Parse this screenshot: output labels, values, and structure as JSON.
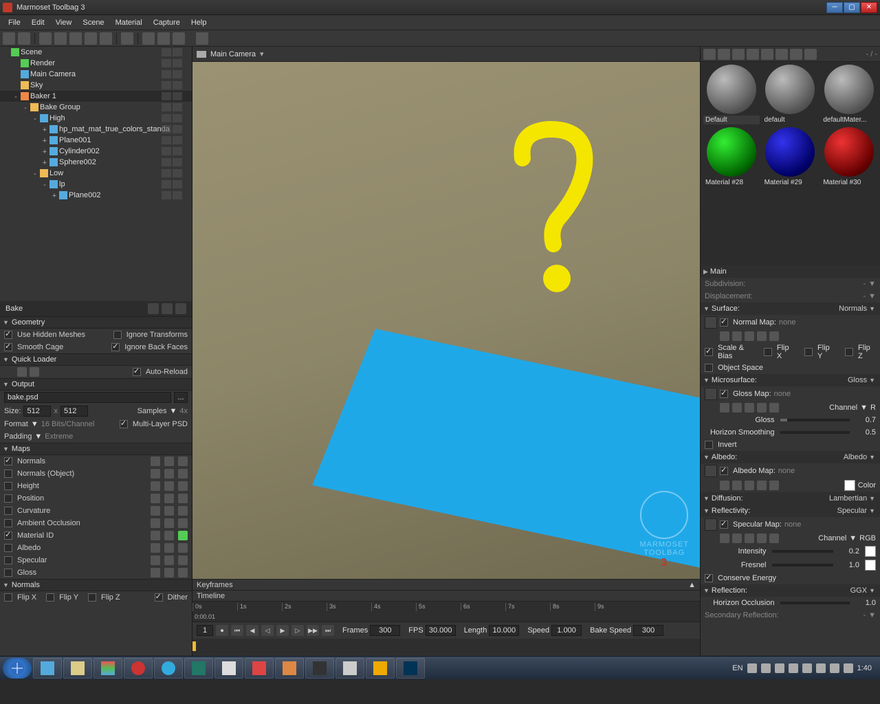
{
  "title": "Marmoset Toolbag 3",
  "menu": [
    "File",
    "Edit",
    "View",
    "Scene",
    "Material",
    "Capture",
    "Help"
  ],
  "camera": "Main Camera",
  "scene_tree": [
    {
      "indent": 0,
      "label": "Scene",
      "ico": "green"
    },
    {
      "indent": 1,
      "label": "Render",
      "ico": "green"
    },
    {
      "indent": 1,
      "label": "Main Camera",
      "ico": "blue"
    },
    {
      "indent": 1,
      "label": "Sky",
      "ico": "yellow"
    },
    {
      "indent": 1,
      "label": "Baker 1",
      "ico": "orange",
      "selected": true,
      "exp": "-"
    },
    {
      "indent": 2,
      "label": "Bake Group",
      "ico": "yellow",
      "exp": "-"
    },
    {
      "indent": 3,
      "label": "High",
      "ico": "blue",
      "exp": "-"
    },
    {
      "indent": 4,
      "label": "hp_mat_mat_true_colors_standa",
      "ico": "blue",
      "exp": "+"
    },
    {
      "indent": 4,
      "label": "Plane001",
      "ico": "blue",
      "exp": "+"
    },
    {
      "indent": 4,
      "label": "Cylinder002",
      "ico": "blue",
      "exp": "+"
    },
    {
      "indent": 4,
      "label": "Sphere002",
      "ico": "blue",
      "exp": "+"
    },
    {
      "indent": 3,
      "label": "Low",
      "ico": "yellow",
      "exp": "-"
    },
    {
      "indent": 4,
      "label": "lp",
      "ico": "blue",
      "exp": "-"
    },
    {
      "indent": 5,
      "label": "Plane002",
      "ico": "blue",
      "exp": "+"
    }
  ],
  "bake": {
    "title": "Bake",
    "geometry": "Geometry",
    "use_hidden": "Use Hidden Meshes",
    "ignore_transforms": "Ignore Transforms",
    "smooth_cage": "Smooth Cage",
    "ignore_backfaces": "Ignore Back Faces",
    "quick_loader": "Quick Loader",
    "auto_reload": "Auto-Reload",
    "output": "Output",
    "filename": "bake.psd",
    "size_label": "Size:",
    "size_w": "512",
    "size_h": "512",
    "samples_label": "Samples",
    "samples_val": "4x",
    "format_label": "Format",
    "format_val": "16 Bits/Channel",
    "multilayer": "Multi-Layer PSD",
    "padding_label": "Padding",
    "padding_val": "Extreme",
    "maps_header": "Maps",
    "maps": [
      {
        "label": "Normals",
        "on": true
      },
      {
        "label": "Normals (Object)",
        "on": false
      },
      {
        "label": "Height",
        "on": false
      },
      {
        "label": "Position",
        "on": false
      },
      {
        "label": "Curvature",
        "on": false
      },
      {
        "label": "Ambient Occlusion",
        "on": false
      },
      {
        "label": "Material ID",
        "on": true,
        "hot": true
      },
      {
        "label": "Albedo",
        "on": false
      },
      {
        "label": "Specular",
        "on": false
      },
      {
        "label": "Gloss",
        "on": false
      }
    ],
    "normals_section": "Normals",
    "flip_x": "Flip X",
    "flip_y": "Flip Y",
    "flip_z": "Flip Z",
    "dither": "Dither"
  },
  "materials": [
    {
      "label": "Default",
      "c": "gray",
      "sel": true
    },
    {
      "label": "default",
      "c": "gray"
    },
    {
      "label": "defaultMater...",
      "c": "gray"
    },
    {
      "label": "Material #28",
      "c": "green"
    },
    {
      "label": "Material #29",
      "c": "blue"
    },
    {
      "label": "Material #30",
      "c": "red"
    }
  ],
  "props": {
    "main": "Main",
    "subdivision": "Subdivision:",
    "displacement": "Displacement:",
    "surface": "Surface:",
    "surface_mode": "Normals",
    "normal_map": "Normal Map:",
    "none": "none",
    "scale_bias": "Scale & Bias",
    "flip_x": "Flip X",
    "flip_y": "Flip Y",
    "flip_z": "Flip Z",
    "object_space": "Object Space",
    "microsurface": "Microsurface:",
    "micro_mode": "Gloss",
    "gloss_map": "Gloss Map:",
    "channel": "Channel",
    "channel_r": "R",
    "gloss": "Gloss",
    "gloss_val": "0.7",
    "horizon": "Horizon Smoothing",
    "horizon_val": "0.5",
    "invert": "Invert",
    "albedo": "Albedo:",
    "albedo_mode": "Albedo",
    "albedo_map": "Albedo Map:",
    "color": "Color",
    "diffusion": "Diffusion:",
    "diffusion_mode": "Lambertian",
    "reflectivity": "Reflectivity:",
    "refl_mode": "Specular",
    "specular_map": "Specular Map:",
    "channel_rgb": "RGB",
    "intensity": "Intensity",
    "intensity_val": "0.2",
    "fresnel": "Fresnel",
    "fresnel_val": "1.0",
    "conserve": "Conserve Energy",
    "reflection": "Reflection:",
    "reflection_mode": "GGX",
    "horizon_occ": "Horizon Occlusion",
    "horizon_occ_val": "1.0",
    "secondary_reflection": "Secondary Reflection:"
  },
  "timeline": {
    "keyframes": "Keyframes",
    "timeline": "Timeline",
    "time": "0:00.01",
    "ticks": [
      "0s",
      "1s",
      "2s",
      "3s",
      "4s",
      "5s",
      "6s",
      "7s",
      "8s",
      "9s"
    ],
    "frame": "1",
    "frames_label": "Frames",
    "frames": "300",
    "fps_label": "FPS",
    "fps": "30.000",
    "length_label": "Length",
    "length": "10.000",
    "speed_label": "Speed",
    "speed": "1.000",
    "bake_speed_label": "Bake Speed",
    "bake_speed": "300"
  },
  "taskbar": {
    "lang": "EN",
    "time": "1:40"
  },
  "watermark": "MARMOSET\nTOOLBAG"
}
